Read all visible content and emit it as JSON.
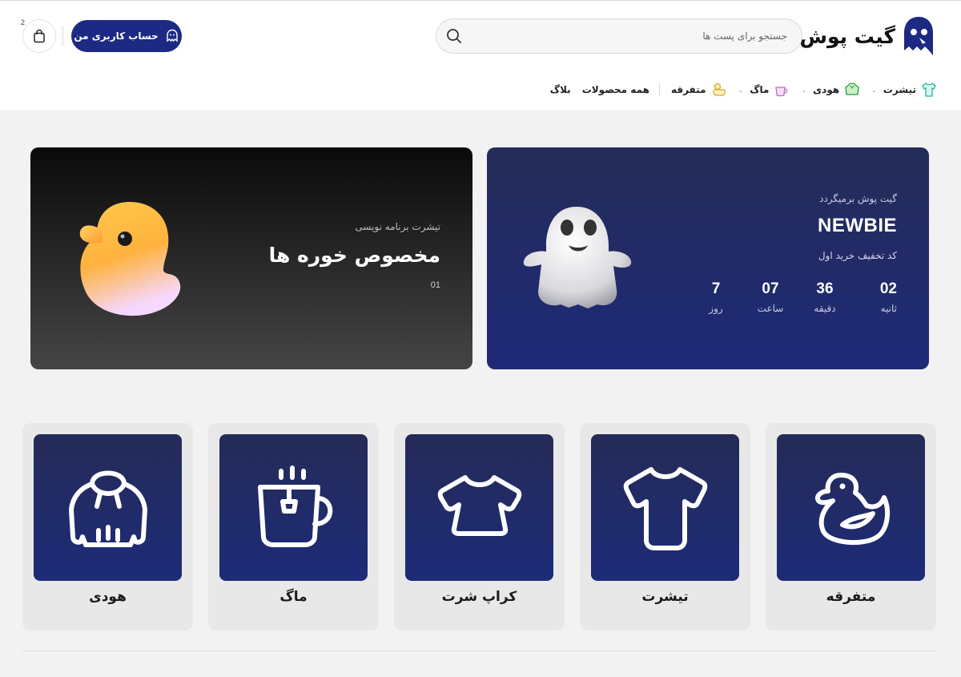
{
  "brand": {
    "name": "گیت پوش"
  },
  "search": {
    "placeholder": "جستجو برای پست ها"
  },
  "header": {
    "account_label": "حساب کاربری من",
    "cart_count": "2"
  },
  "nav": [
    {
      "label": "تیشرت",
      "has_dropdown": true,
      "icon": "tshirt-icon"
    },
    {
      "label": "هودی",
      "has_dropdown": true,
      "icon": "hoodie-icon"
    },
    {
      "label": "ماگ",
      "has_dropdown": true,
      "icon": "mug-icon"
    },
    {
      "label": "متفرقه",
      "has_dropdown": false,
      "icon": "duck-icon"
    },
    {
      "label": "همه محصولات"
    },
    {
      "label": "بلاگ"
    }
  ],
  "promo": {
    "subtitle": "گیت پوش برمیگردد",
    "code": "NEWBIE",
    "description": "کد تخفیف خرید اول",
    "countdown": [
      {
        "value": "02",
        "unit": "ثانیه"
      },
      {
        "value": "36",
        "unit": "دقیقه"
      },
      {
        "value": "07",
        "unit": "ساعت"
      },
      {
        "value": "7",
        "unit": "روز"
      }
    ],
    "colors": {
      "bg_top": "#252c57",
      "bg_bottom": "#1e2a78"
    }
  },
  "dark_banner": {
    "subtitle": "تیشرت برنامه نویسی",
    "title": "مخصوص خوره ها",
    "index": "01"
  },
  "categories": [
    {
      "label": "متفرقه",
      "icon": "duck-icon"
    },
    {
      "label": "تیشرت",
      "icon": "tshirt-icon"
    },
    {
      "label": "کراپ شرت",
      "icon": "crop-shirt-icon"
    },
    {
      "label": "ماگ",
      "icon": "mug-icon"
    },
    {
      "label": "هودی",
      "icon": "hoodie-icon"
    }
  ],
  "theme": {
    "accent": "#1c2a83",
    "tile": "#1f2a6e"
  }
}
